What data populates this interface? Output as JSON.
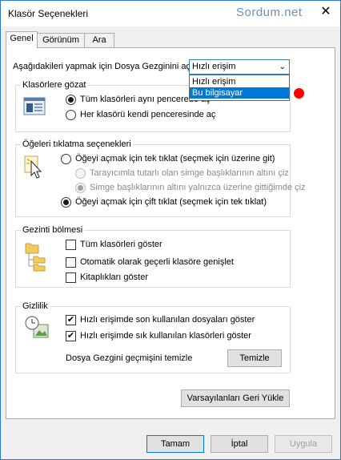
{
  "window": {
    "title": "Klasör Seçenekleri",
    "watermark": "Sordum.net",
    "close_glyph": "✕"
  },
  "tabs": [
    {
      "label": "Genel"
    },
    {
      "label": "Görünüm"
    },
    {
      "label": "Ara"
    }
  ],
  "general": {
    "open_label": "Aşağıdakileri yapmak için Dosya Gezginini aç:",
    "open_value": "Hızlı erişim",
    "open_options": [
      "Hızlı erişim",
      "Bu bilgisayar"
    ],
    "highlighted_option": "Bu bilgisayar"
  },
  "browse": {
    "title": "Klasörlere gözat",
    "same_window": "Tüm klasörleri aynı pencerede aç",
    "own_window": "Her klasörü kendi penceresinde aç"
  },
  "click": {
    "title": "Öğeleri tıklatma seçenekleri",
    "single": "Öğeyi açmak için tek tıklat (seçmek için üzerine git)",
    "underline_browser": "Tarayıcımla tutarlı olan simge başlıklarının altını çiz",
    "underline_hover": "Simge başlıklarının altını yalnızca üzerine gittiğimde çiz",
    "double": "Öğeyi açmak için çift tıklat (seçmek için tek tıklat)"
  },
  "nav": {
    "title": "Gezinti bölmesi",
    "show_all": "Tüm klasörleri göster",
    "auto_expand": "Otomatik olarak geçerli klasöre genişlet",
    "show_libraries": "Kitaplıkları göster"
  },
  "privacy": {
    "title": "Gizlilik",
    "recent_files": "Hızlı erişimde son kullanılan dosyaları göster",
    "frequent_folders": "Hızlı erişimde sık kullanılan klasörleri göster",
    "clear_label": "Dosya Gezgini geçmişini temizle",
    "clear_button": "Temizle"
  },
  "restore_button": "Varsayılanları Geri Yükle",
  "footer": {
    "ok": "Tamam",
    "cancel": "İptal",
    "apply": "Uygula"
  },
  "state": {
    "browse_same_window": true,
    "double_click": true,
    "show_all_folders": false,
    "auto_expand": false,
    "show_libraries": false,
    "recent_files": true,
    "frequent_folders": true
  },
  "icons": [
    "close-icon",
    "dropdown-arrow-icon",
    "folder-window-icon",
    "pointer-click-icon",
    "folder-tree-icon",
    "privacy-clock-icon",
    "checkmark-icon"
  ],
  "colors": {
    "window_border": "#2b78c5",
    "selection": "#0078d7",
    "watermark": "#6b8fb8",
    "marker": "#ff0000"
  }
}
